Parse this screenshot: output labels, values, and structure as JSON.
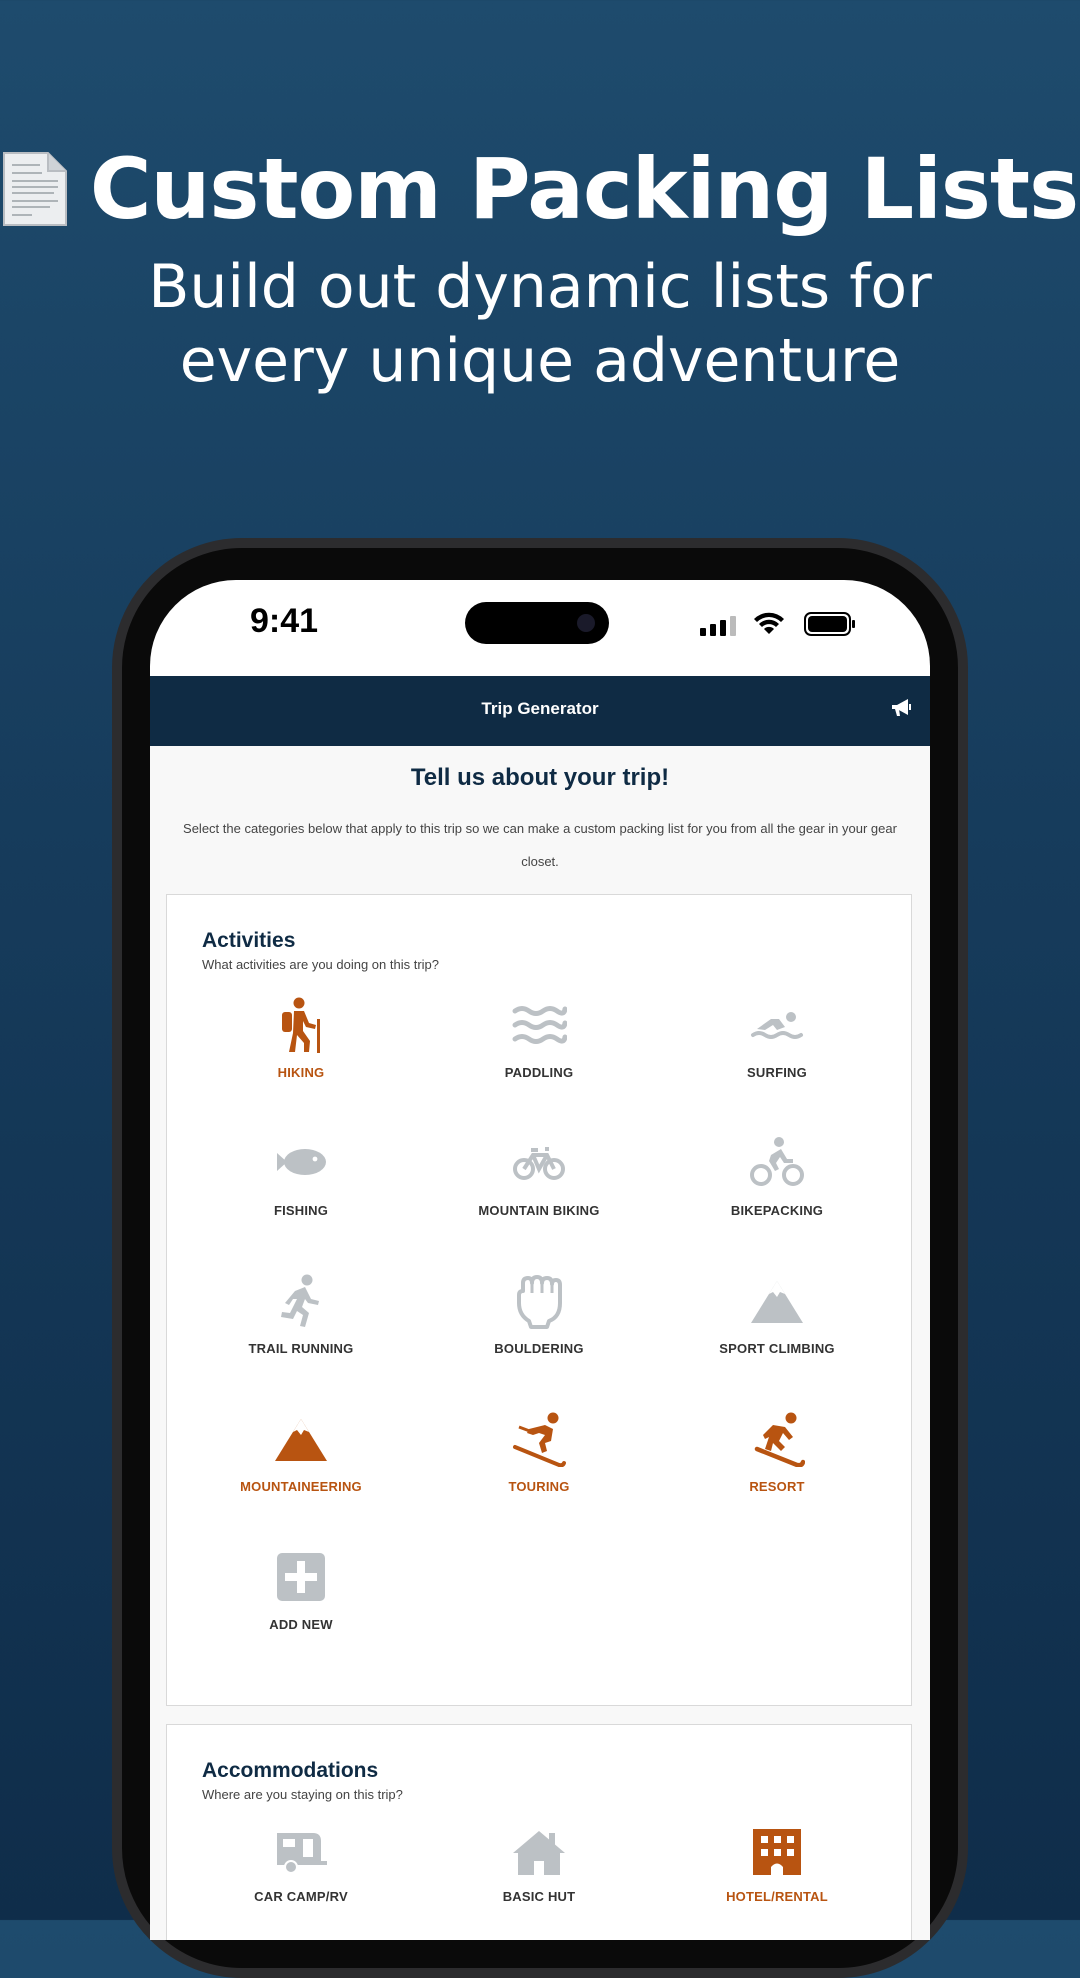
{
  "hero": {
    "title": "Custom Packing Lists",
    "subtitle_line1": "Build out dynamic lists for",
    "subtitle_line2": "every unique adventure"
  },
  "status_bar": {
    "time": "9:41"
  },
  "navbar": {
    "title": "Trip Generator"
  },
  "intro": {
    "title": "Tell us about your trip!",
    "text": "Select the categories below that apply to this trip so we can make a custom packing list for you from all the gear in your gear closet."
  },
  "activities": {
    "title": "Activities",
    "subtitle": "What activities are you doing on this trip?",
    "items": [
      {
        "label": "HIKING",
        "icon": "hiking-icon",
        "selected": true
      },
      {
        "label": "PADDLING",
        "icon": "water-waves-icon",
        "selected": false
      },
      {
        "label": "SURFING",
        "icon": "swimmer-icon",
        "selected": false
      },
      {
        "label": "FISHING",
        "icon": "fish-icon",
        "selected": false
      },
      {
        "label": "MOUNTAIN BIKING",
        "icon": "bicycle-icon",
        "selected": false
      },
      {
        "label": "BIKEPACKING",
        "icon": "cyclist-icon",
        "selected": false
      },
      {
        "label": "TRAIL RUNNING",
        "icon": "runner-icon",
        "selected": false
      },
      {
        "label": "BOULDERING",
        "icon": "fist-icon",
        "selected": false
      },
      {
        "label": "SPORT CLIMBING",
        "icon": "mountain-icon",
        "selected": false
      },
      {
        "label": "MOUNTAINEERING",
        "icon": "mountain-icon",
        "selected": true
      },
      {
        "label": "TOURING",
        "icon": "skier-icon",
        "selected": true
      },
      {
        "label": "RESORT",
        "icon": "snowboarder-icon",
        "selected": true
      },
      {
        "label": "ADD NEW",
        "icon": "plus-square-icon",
        "selected": false
      }
    ]
  },
  "accommodations": {
    "title": "Accommodations",
    "subtitle": "Where are you staying on this trip?",
    "items": [
      {
        "label": "CAR CAMP/RV",
        "icon": "camper-icon",
        "selected": false
      },
      {
        "label": "BASIC HUT",
        "icon": "house-icon",
        "selected": false
      },
      {
        "label": "HOTEL/RENTAL",
        "icon": "hotel-icon",
        "selected": true
      }
    ]
  },
  "colors": {
    "selected": "#b85411",
    "unselected": "#bcc1c5",
    "navy": "#0f2b44"
  }
}
